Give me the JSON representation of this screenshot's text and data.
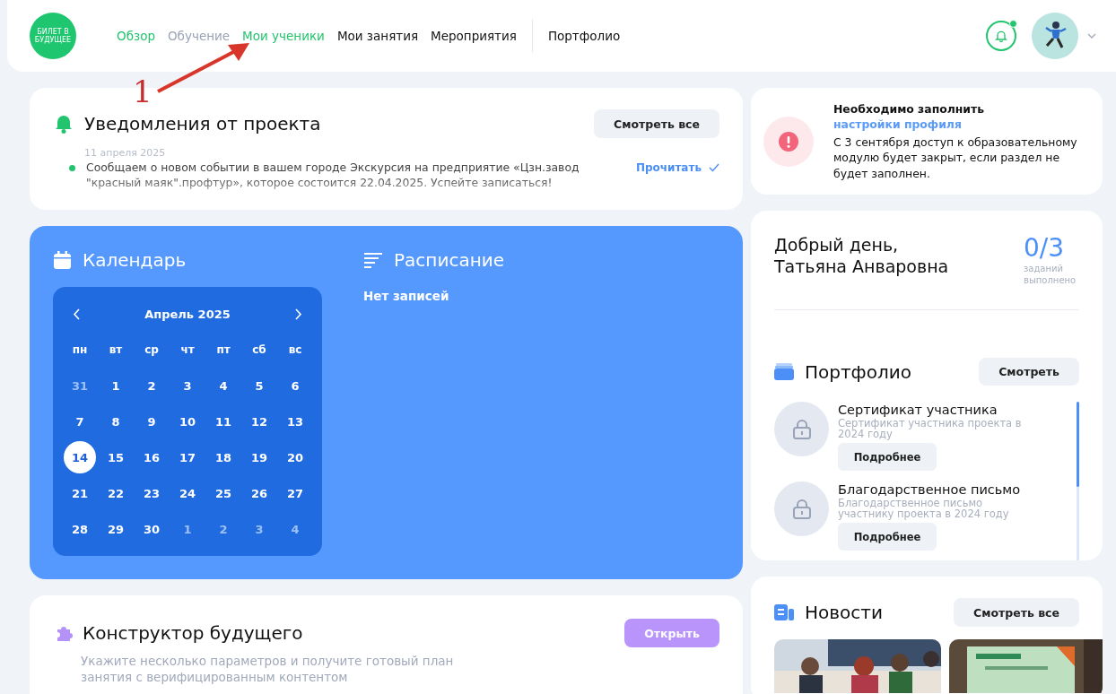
{
  "header": {
    "logo_text": "БИЛЕТ В БУДУЩЕЕ",
    "nav": [
      {
        "label": "Обзор",
        "kind": "accent"
      },
      {
        "label": "Обучение",
        "kind": "muted"
      },
      {
        "label": "Мои ученики",
        "kind": "accent"
      },
      {
        "label": "Мои занятия",
        "kind": "plain"
      },
      {
        "label": "Мероприятия",
        "kind": "plain"
      },
      {
        "label": "Портфолио",
        "kind": "separated"
      }
    ],
    "bell_unread": true
  },
  "annotation": {
    "label": "1"
  },
  "notifications": {
    "title": "Уведомления от проекта",
    "button": "Смотреть все",
    "date": "11 апреля 2025",
    "unread": true,
    "message": "Сообщаем о новом событии в вашем городе Экскурсия на предприятие «Цзн.завод \"красный маяк\".профтур», которое состоится 22.04.2025. Успейте записаться!",
    "read_action": "Прочитать"
  },
  "calendar": {
    "title": "Календарь",
    "month": "Апрель 2025",
    "weekdays": [
      "пн",
      "вт",
      "ср",
      "чт",
      "пт",
      "сб",
      "вс"
    ],
    "days": [
      {
        "label": "31",
        "other_month": true,
        "selected": false
      },
      {
        "label": "1",
        "other_month": false,
        "selected": false
      },
      {
        "label": "2",
        "other_month": false,
        "selected": false
      },
      {
        "label": "3",
        "other_month": false,
        "selected": false
      },
      {
        "label": "4",
        "other_month": false,
        "selected": false
      },
      {
        "label": "5",
        "other_month": false,
        "selected": false
      },
      {
        "label": "6",
        "other_month": false,
        "selected": false
      },
      {
        "label": "7",
        "other_month": false,
        "selected": false
      },
      {
        "label": "8",
        "other_month": false,
        "selected": false
      },
      {
        "label": "9",
        "other_month": false,
        "selected": false
      },
      {
        "label": "10",
        "other_month": false,
        "selected": false
      },
      {
        "label": "11",
        "other_month": false,
        "selected": false
      },
      {
        "label": "12",
        "other_month": false,
        "selected": false
      },
      {
        "label": "13",
        "other_month": false,
        "selected": false
      },
      {
        "label": "14",
        "other_month": false,
        "selected": true
      },
      {
        "label": "15",
        "other_month": false,
        "selected": false
      },
      {
        "label": "16",
        "other_month": false,
        "selected": false
      },
      {
        "label": "17",
        "other_month": false,
        "selected": false
      },
      {
        "label": "18",
        "other_month": false,
        "selected": false
      },
      {
        "label": "19",
        "other_month": false,
        "selected": false
      },
      {
        "label": "20",
        "other_month": false,
        "selected": false
      },
      {
        "label": "21",
        "other_month": false,
        "selected": false
      },
      {
        "label": "22",
        "other_month": false,
        "selected": false
      },
      {
        "label": "23",
        "other_month": false,
        "selected": false
      },
      {
        "label": "24",
        "other_month": false,
        "selected": false
      },
      {
        "label": "25",
        "other_month": false,
        "selected": false
      },
      {
        "label": "26",
        "other_month": false,
        "selected": false
      },
      {
        "label": "27",
        "other_month": false,
        "selected": false
      },
      {
        "label": "28",
        "other_month": false,
        "selected": false
      },
      {
        "label": "29",
        "other_month": false,
        "selected": false
      },
      {
        "label": "30",
        "other_month": false,
        "selected": false
      },
      {
        "label": "1",
        "other_month": true,
        "selected": false
      },
      {
        "label": "2",
        "other_month": true,
        "selected": false
      },
      {
        "label": "3",
        "other_month": true,
        "selected": false
      },
      {
        "label": "4",
        "other_month": true,
        "selected": false
      }
    ]
  },
  "schedule": {
    "title": "Расписание",
    "empty_text": "Нет записей"
  },
  "constructor": {
    "title": "Конструктор будущего",
    "description": "Укажите несколько параметров и получите готовый план занятия с верифицированным контентом",
    "button": "Открыть"
  },
  "alert": {
    "text_before": "Необходимо заполнить ",
    "link": "настройки профиля",
    "body": "С 3 сентября доступ к образовательному модулю будет закрыт, если раздел не будет заполнен."
  },
  "greeting": {
    "text": "Добрый день, Татьяна Анваровна",
    "progress": "0/3",
    "progress_caption": "заданий выполнено"
  },
  "portfolio": {
    "title": "Портфолио",
    "button": "Смотреть",
    "items": [
      {
        "title": "Сертификат участника",
        "description": "Сертификат участника проекта в 2024 году",
        "button": "Подробнее",
        "locked": true
      },
      {
        "title": "Благодарственное письмо",
        "description": "Благодарственное письмо участнику проекта в 2024 году",
        "button": "Подробнее",
        "locked": true
      }
    ]
  },
  "news": {
    "title": "Новости",
    "button": "Смотреть все"
  }
}
